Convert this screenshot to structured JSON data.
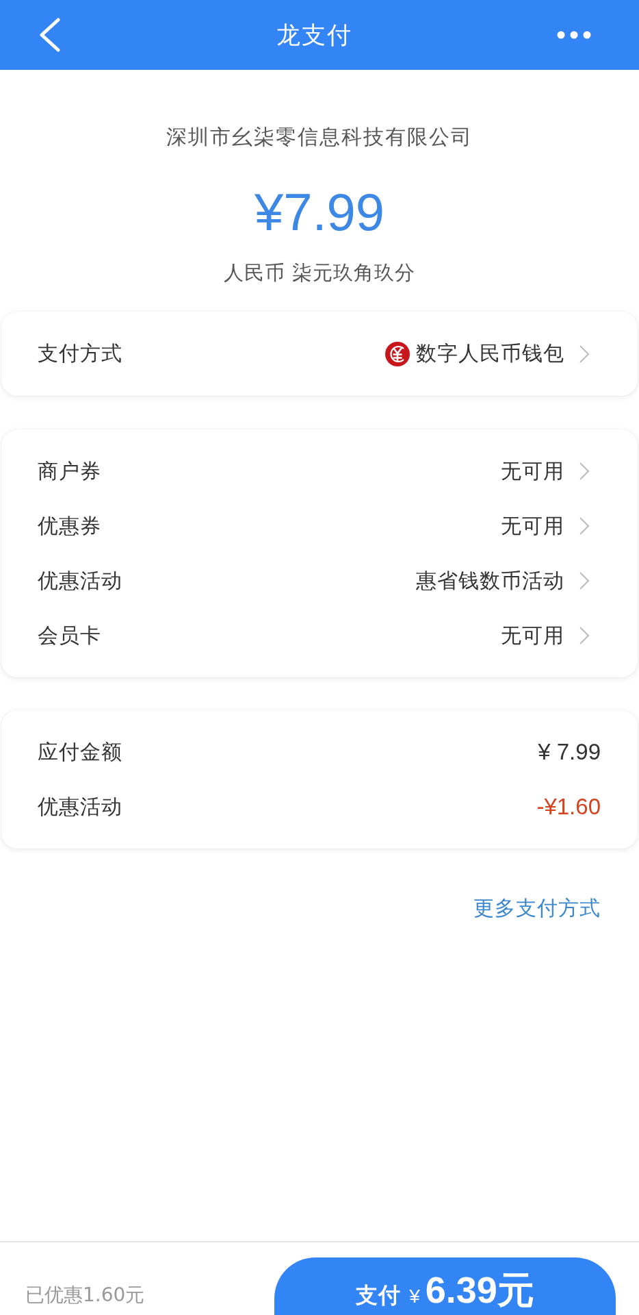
{
  "header": {
    "title": "龙支付"
  },
  "merchant": {
    "name": "深圳市幺柒零信息科技有限公司",
    "amount": "¥7.99",
    "amount_in_words": "人民币 柒元玖角玖分"
  },
  "payment_method": {
    "label": "支付方式",
    "value": "数字人民币钱包"
  },
  "discounts": [
    {
      "label": "商户券",
      "value": "无可用"
    },
    {
      "label": "优惠券",
      "value": "无可用"
    },
    {
      "label": "优惠活动",
      "value": "惠省钱数币活动"
    },
    {
      "label": "会员卡",
      "value": "无可用"
    }
  ],
  "summary": [
    {
      "label": "应付金额",
      "value": "¥ 7.99",
      "kind": "amount"
    },
    {
      "label": "优惠活动",
      "value": "-¥1.60",
      "kind": "deduction"
    }
  ],
  "more_link": "更多支付方式",
  "footer": {
    "saved": "已优惠1.60元",
    "pay_button": {
      "label": "支付",
      "currency": "¥",
      "amount": "6.39元"
    }
  }
}
